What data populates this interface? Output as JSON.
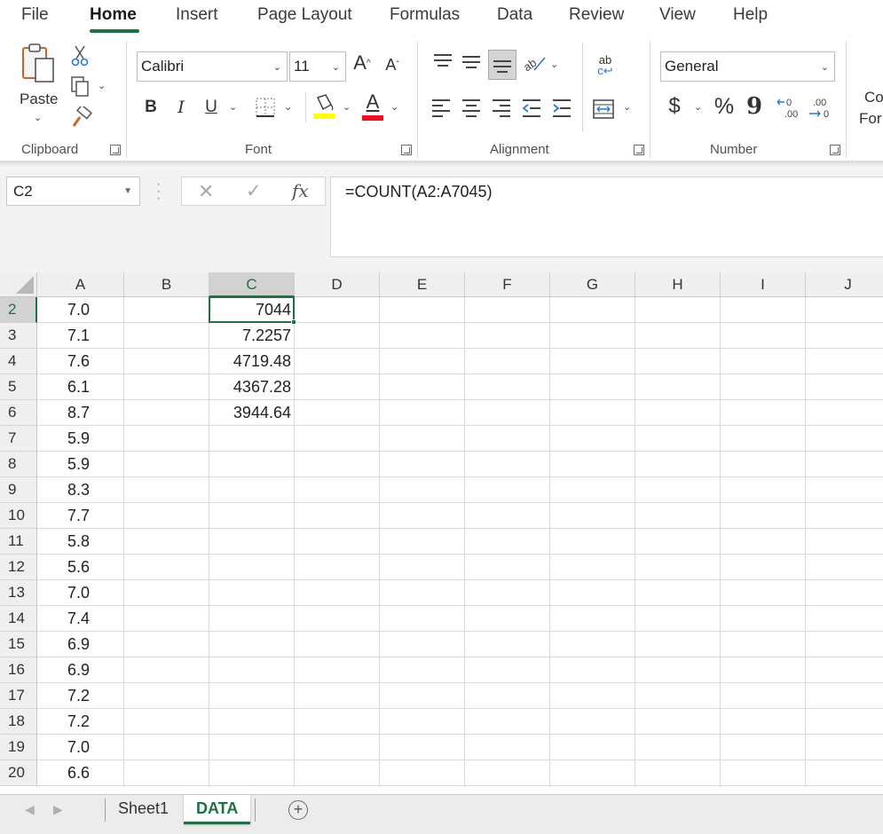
{
  "menu": {
    "tabs": [
      "File",
      "Home",
      "Insert",
      "Page Layout",
      "Formulas",
      "Data",
      "Review",
      "View",
      "Help"
    ],
    "active": "Home"
  },
  "ribbon": {
    "clipboard": {
      "label": "Clipboard",
      "paste_label": "Paste"
    },
    "font": {
      "label": "Font",
      "font_name": "Calibri",
      "font_size": "11",
      "bold": "B",
      "italic": "I",
      "underline": "U",
      "grow": "A",
      "shrink": "A",
      "font_color_glyph": "A"
    },
    "alignment": {
      "label": "Alignment",
      "wrap_glyph": "ab"
    },
    "number": {
      "label": "Number",
      "format": "General",
      "currency": "$",
      "percent": "%",
      "comma": "9"
    },
    "next_group": {
      "line1": "Co",
      "line2": "For"
    }
  },
  "formula_bar": {
    "name_box": "C2",
    "cancel": "✕",
    "enter": "✓",
    "fx": "fx",
    "formula": "=COUNT(A2:A7045)"
  },
  "grid": {
    "columns": [
      "A",
      "B",
      "C",
      "D",
      "E",
      "F",
      "G",
      "H",
      "I",
      "J"
    ],
    "active_column": "C",
    "active_row": "2",
    "rows": [
      {
        "num": "2",
        "a": "7.0",
        "c": "7044"
      },
      {
        "num": "3",
        "a": "7.1",
        "c": "7.2257"
      },
      {
        "num": "4",
        "a": "7.6",
        "c": "4719.48"
      },
      {
        "num": "5",
        "a": "6.1",
        "c": "4367.28"
      },
      {
        "num": "6",
        "a": "8.7",
        "c": "3944.64"
      },
      {
        "num": "7",
        "a": "5.9",
        "c": ""
      },
      {
        "num": "8",
        "a": "5.9",
        "c": ""
      },
      {
        "num": "9",
        "a": "8.3",
        "c": ""
      },
      {
        "num": "10",
        "a": "7.7",
        "c": ""
      },
      {
        "num": "11",
        "a": "5.8",
        "c": ""
      },
      {
        "num": "12",
        "a": "5.6",
        "c": ""
      },
      {
        "num": "13",
        "a": "7.0",
        "c": ""
      },
      {
        "num": "14",
        "a": "7.4",
        "c": ""
      },
      {
        "num": "15",
        "a": "6.9",
        "c": ""
      },
      {
        "num": "16",
        "a": "6.9",
        "c": ""
      },
      {
        "num": "17",
        "a": "7.2",
        "c": ""
      },
      {
        "num": "18",
        "a": "7.2",
        "c": ""
      },
      {
        "num": "19",
        "a": "7.0",
        "c": ""
      },
      {
        "num": "20",
        "a": "6.6",
        "c": ""
      }
    ]
  },
  "sheets": {
    "tabs": [
      "Sheet1",
      "DATA"
    ],
    "active": "DATA",
    "add": "+"
  },
  "colors": {
    "accent": "#1e7145",
    "highlight": "#ffff00",
    "font_color": "#e81123"
  }
}
